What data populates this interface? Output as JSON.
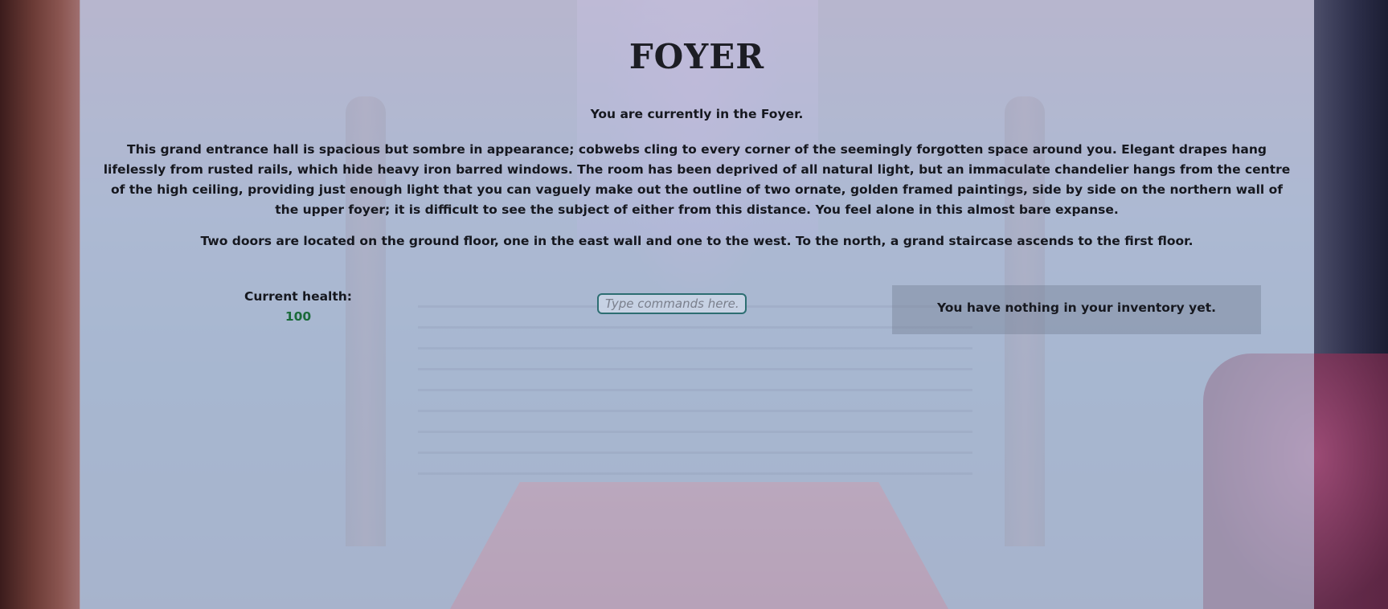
{
  "room": {
    "title": "FOYER",
    "current_location": "You are currently in the Foyer.",
    "description": "This grand entrance hall is spacious but sombre in appearance; cobwebs cling to every corner of the seemingly forgotten space around you. Elegant drapes hang lifelessly from rusted rails, which hide heavy iron barred windows. The room has been deprived of all natural light, but an immaculate chandelier hangs from the centre of the high ceiling, providing just enough light that you can vaguely make out the outline of two ornate, golden framed paintings, side by side on the northern wall of the upper foyer; it is difficult to see the subject of either from this distance. You feel alone in this almost bare expanse.",
    "exits": "Two doors are located on the ground floor, one in the east wall and one to the west. To the north, a grand staircase ascends to the first floor."
  },
  "status": {
    "health_label": "Current health:",
    "health_value": "100",
    "health_color": "#1b6a3a"
  },
  "command": {
    "value": "",
    "placeholder": "Type commands here..."
  },
  "inventory": {
    "message": "You have nothing in your inventory yet."
  },
  "background": {
    "scene": "foyer with grand staircase, chandelier and stained glass window",
    "panel_color": "#b6c4dc"
  }
}
